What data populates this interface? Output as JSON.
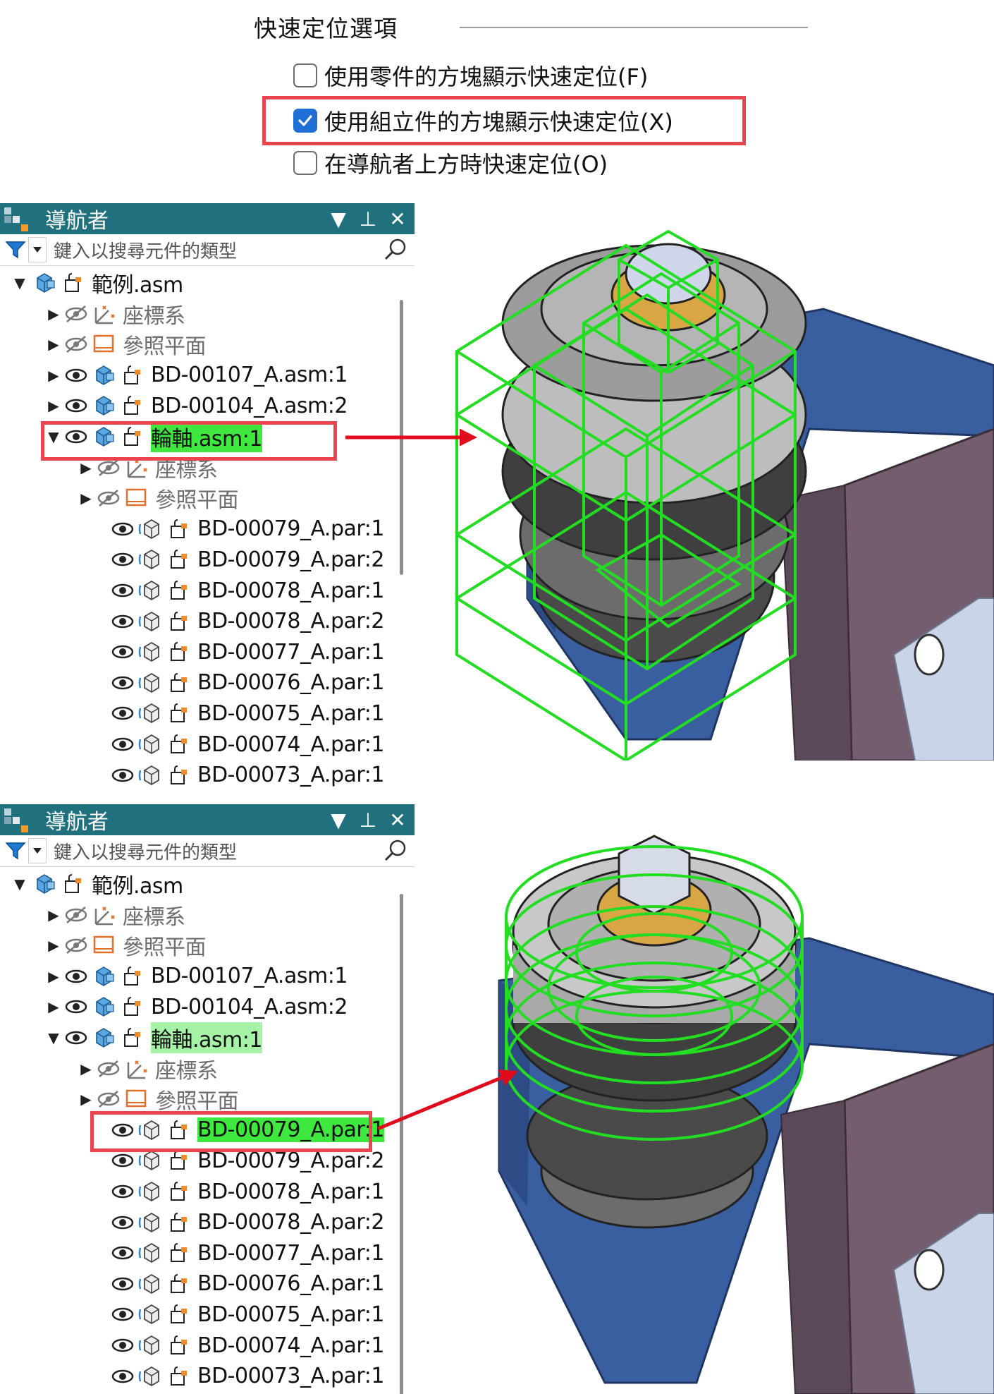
{
  "options": {
    "title": "快速定位選項",
    "items": [
      {
        "label": "使用零件的方塊顯示快速定位(F)",
        "checked": false
      },
      {
        "label": "使用組立件的方塊顯示快速定位(X)",
        "checked": true
      },
      {
        "label": "在導航者上方時快速定位(O)",
        "checked": false
      }
    ]
  },
  "navigator": {
    "title": "導航者",
    "search_placeholder": "鍵入以搜尋元件的類型",
    "root": "範例.asm",
    "coord": "座標系",
    "ref_planes": "參照平面",
    "subasm1": "BD-00107_A.asm:1",
    "subasm2": "BD-00104_A.asm:2",
    "subasm3": "輪軸.asm:1",
    "parts": [
      "BD-00079_A.par:1",
      "BD-00079_A.par:2",
      "BD-00078_A.par:1",
      "BD-00078_A.par:2",
      "BD-00077_A.par:1",
      "BD-00076_A.par:1",
      "BD-00075_A.par:1",
      "BD-00074_A.par:1",
      "BD-00073_A.par:1"
    ]
  },
  "colors": {
    "header": "#20707e",
    "highlight": "#3ee83e",
    "callout": "#e8454f",
    "model_blue": "#3a5fa0",
    "wire": "#22dd22"
  },
  "icons": [
    "filter-icon",
    "search-icon",
    "eye-icon",
    "eye-off-icon",
    "coord-icon",
    "plane-icon",
    "assembly-icon",
    "part-icon",
    "lock-icon",
    "pin-icon",
    "close-icon"
  ]
}
